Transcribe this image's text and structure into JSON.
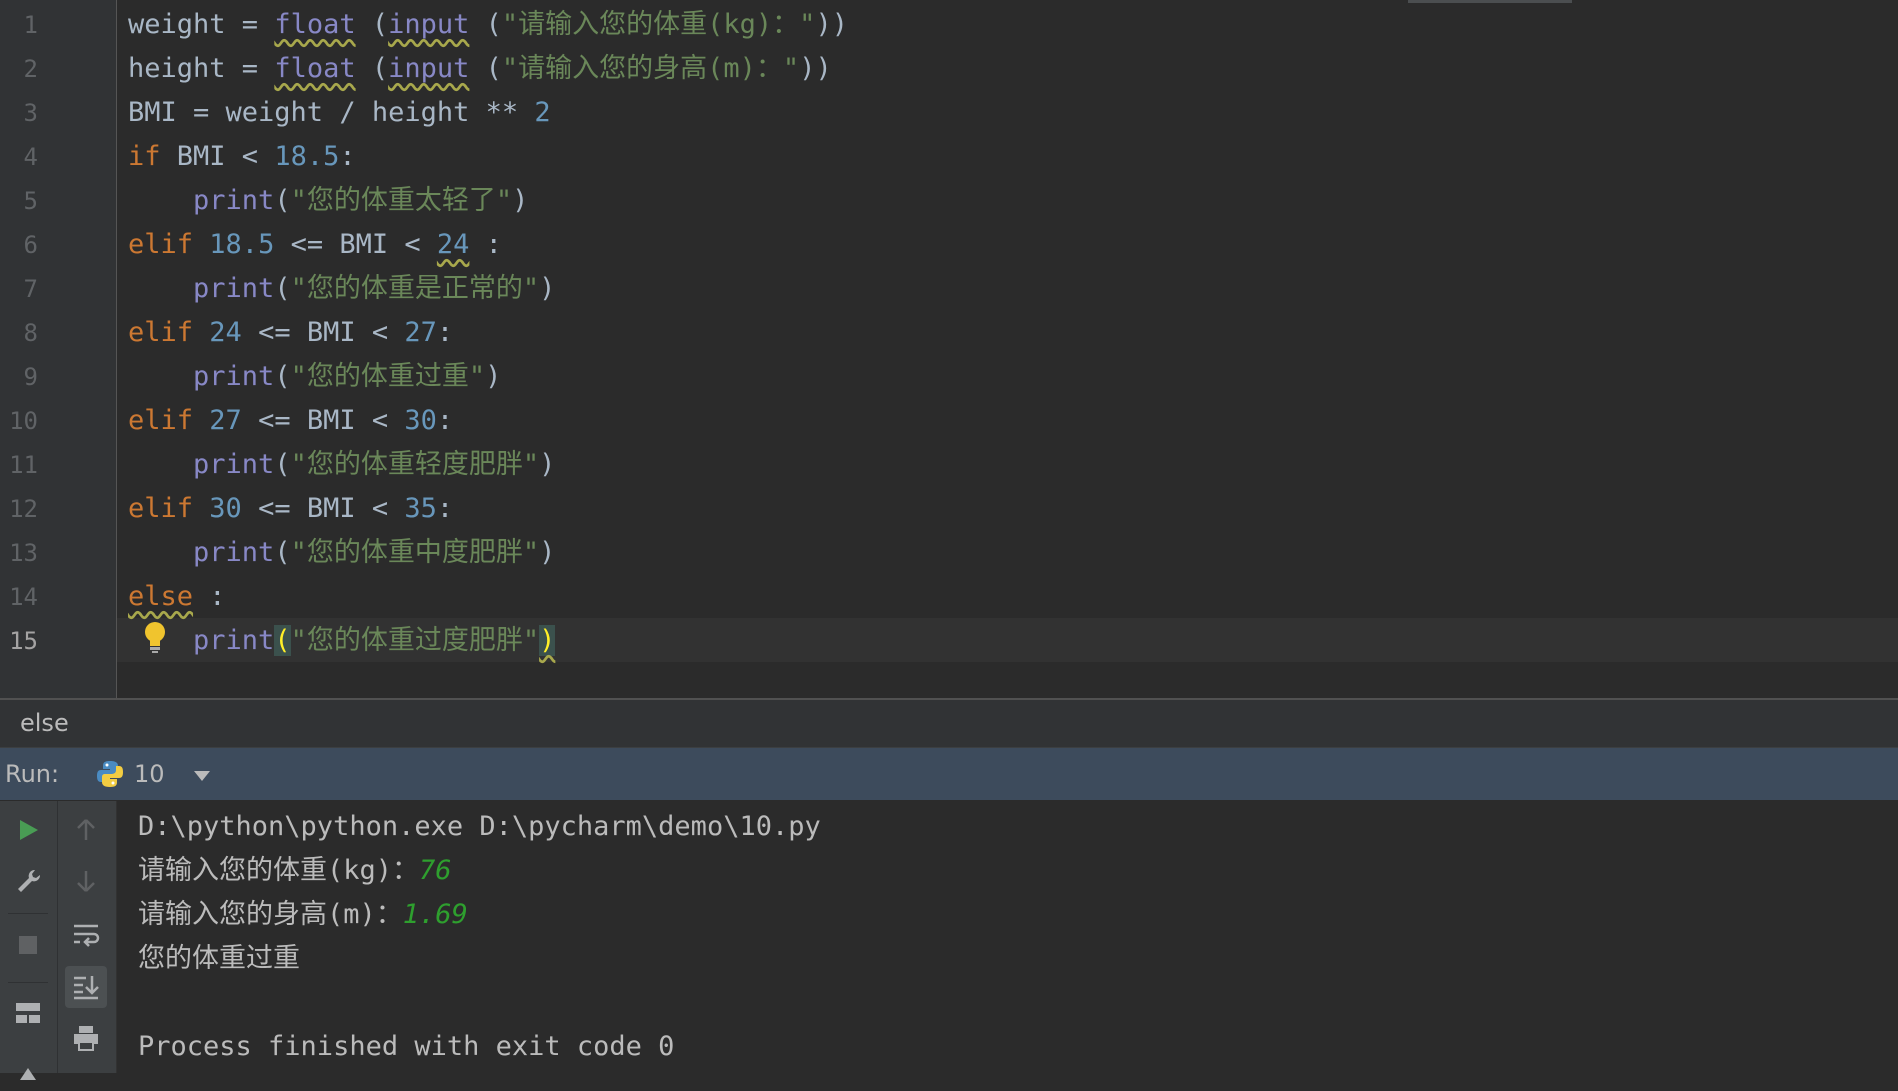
{
  "editor": {
    "line_numbers": [
      "1",
      "2",
      "3",
      "4",
      "5",
      "6",
      "7",
      "8",
      "9",
      "10",
      "11",
      "12",
      "13",
      "14",
      "15"
    ],
    "current_line": "15",
    "code": {
      "l1": {
        "a": "weight = ",
        "b": "float",
        "c": " (",
        "d": "input",
        "e": " (",
        "f": "\"请输入您的体重(kg)：\"",
        "g": "))"
      },
      "l2": {
        "a": "height = ",
        "b": "float",
        "c": " (",
        "d": "input",
        "e": " (",
        "f": "\"请输入您的身高(m)：\"",
        "g": "))"
      },
      "l3": {
        "a": "BMI = weight / height ** ",
        "b": "2"
      },
      "l4": {
        "kw": "if",
        "a": " BMI < ",
        "n": "18.5",
        "b": ":"
      },
      "l5": {
        "fn": "print",
        "a": "(",
        "s": "\"您的体重太轻了\"",
        "b": ")"
      },
      "l6": {
        "kw": "elif",
        "a": " ",
        "n1": "18.5",
        "b": " <= BMI < ",
        "n2": "24",
        "c": " :"
      },
      "l7": {
        "fn": "print",
        "a": "(",
        "s": "\"您的体重是正常的\"",
        "b": ")"
      },
      "l8": {
        "kw": "elif",
        "a": " ",
        "n1": "24",
        "b": " <= BMI < ",
        "n2": "27",
        "c": ":"
      },
      "l9": {
        "fn": "print",
        "a": "(",
        "s": "\"您的体重过重\"",
        "b": ")"
      },
      "l10": {
        "kw": "elif",
        "a": " ",
        "n1": "27",
        "b": " <= BMI < ",
        "n2": "30",
        "c": ":"
      },
      "l11": {
        "fn": "print",
        "a": "(",
        "s": "\"您的体重轻度肥胖\"",
        "b": ")"
      },
      "l12": {
        "kw": "elif",
        "a": " ",
        "n1": "30",
        "b": " <= BMI < ",
        "n2": "35",
        "c": ":"
      },
      "l13": {
        "fn": "print",
        "a": "(",
        "s": "\"您的体重中度肥胖\"",
        "b": ")"
      },
      "l14": {
        "kw": "else",
        "a": " :"
      },
      "l15": {
        "fn": "print",
        "a": "(",
        "s": "\"您的体重过度肥胖\"",
        "b": ")"
      }
    }
  },
  "breadcrumb": {
    "text": "else"
  },
  "run": {
    "label": "Run:",
    "config": "10"
  },
  "toolbar_icons": [
    "run-icon",
    "up-arrow-icon",
    "wrench-icon",
    "down-arrow-icon",
    "stop-icon",
    "soft-wrap-icon",
    "layout-icon",
    "scroll-to-end-icon",
    "print-icon"
  ],
  "console": {
    "cmd": "D:\\python\\python.exe D:\\pycharm\\demo\\10.py",
    "prompt1": "请输入您的体重(kg)：",
    "input1": "76",
    "prompt2": "请输入您的身高(m)：",
    "input2": "1.69",
    "result": "您的体重过重",
    "exit": "Process finished with exit code 0"
  },
  "colors": {
    "keyword": "#cc7832",
    "builtin": "#8888c6",
    "number": "#6897bb",
    "string": "#6a8759",
    "user_input": "#2e9f2e",
    "run_header": "#3d4b5c"
  }
}
